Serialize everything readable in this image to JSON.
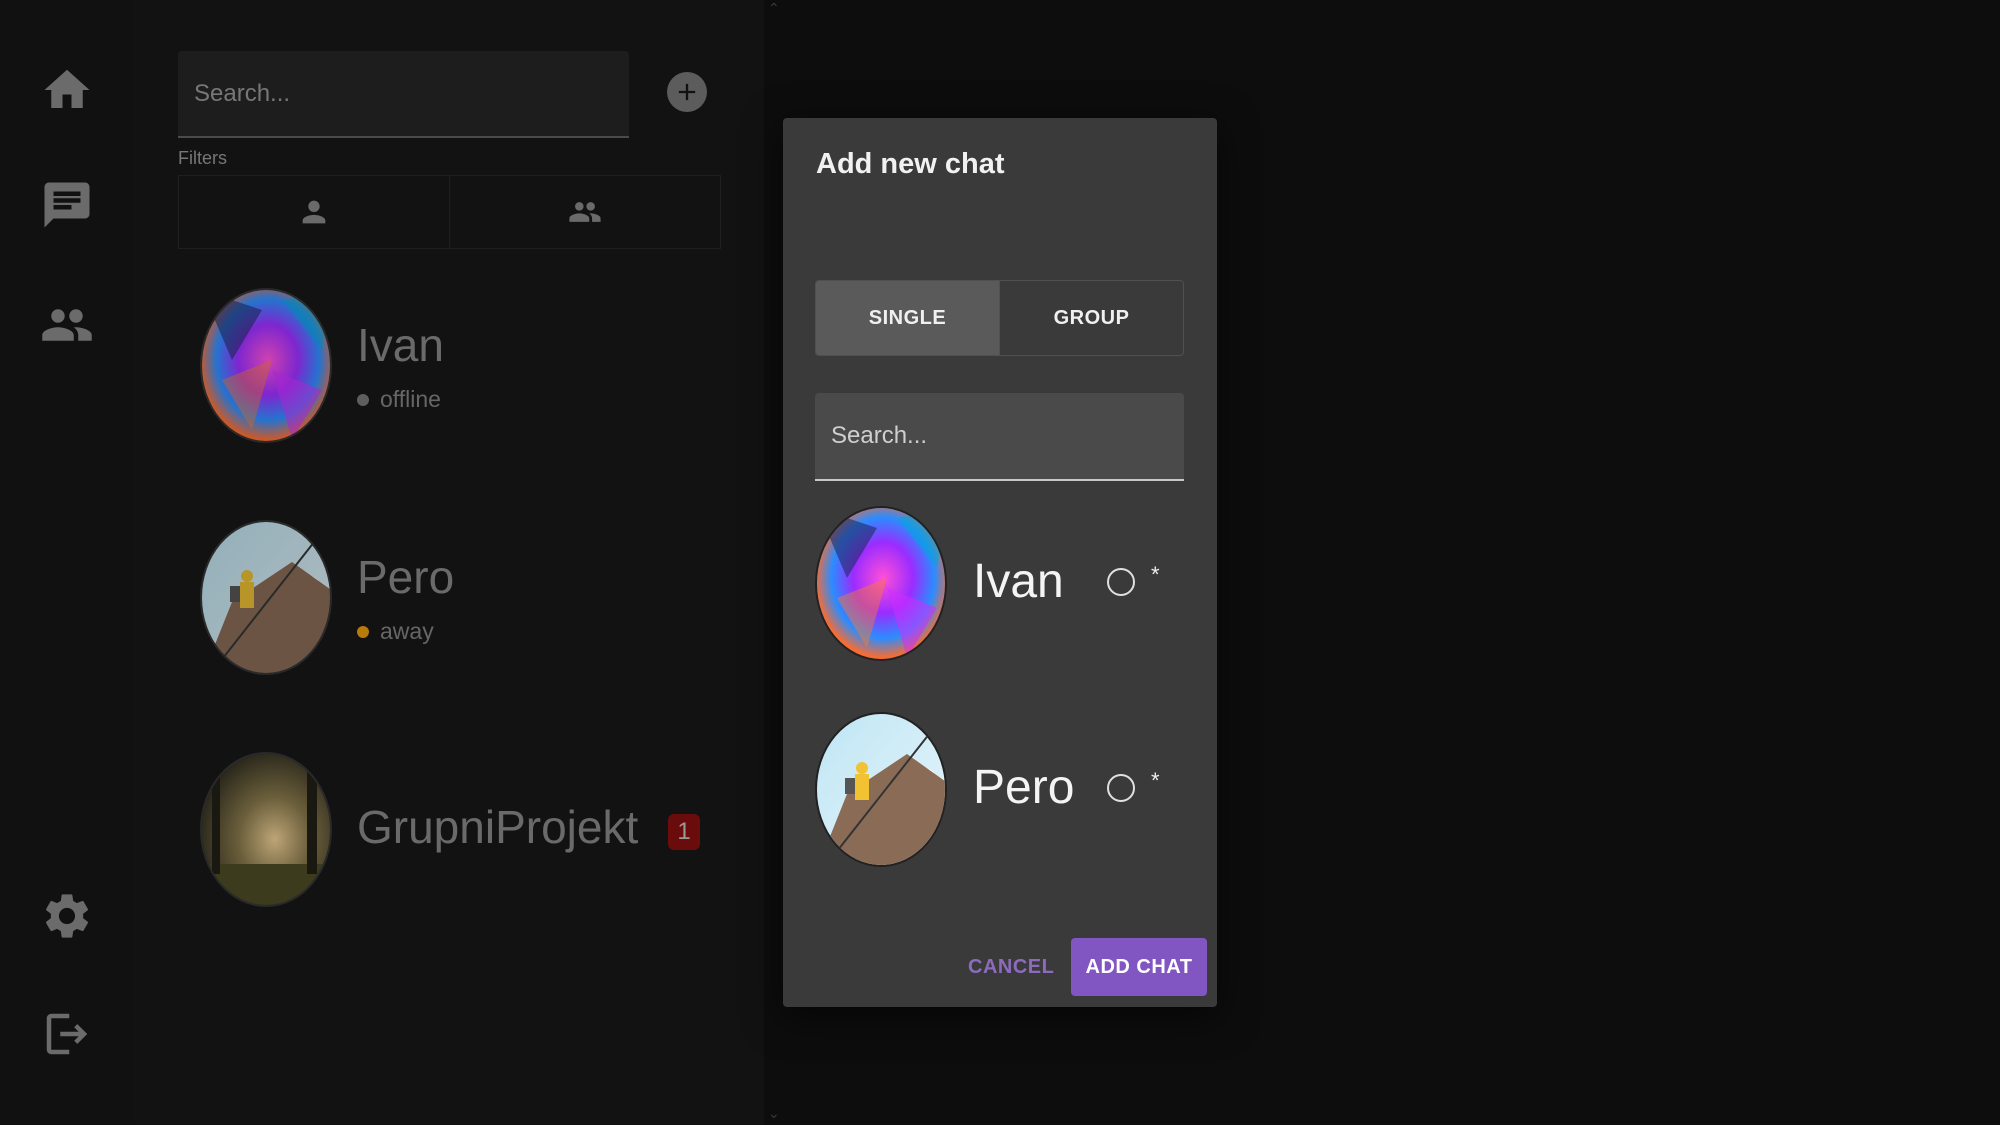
{
  "sidebar": {
    "items": [
      {
        "icon": "home-icon"
      },
      {
        "icon": "chat-icon"
      },
      {
        "icon": "contacts-icon"
      },
      {
        "icon": "settings-icon"
      },
      {
        "icon": "logout-icon"
      }
    ]
  },
  "chat_list": {
    "search_placeholder": "Search...",
    "filters_label": "Filters",
    "filters": [
      {
        "icon": "person-icon"
      },
      {
        "icon": "group-icon"
      }
    ],
    "chats": [
      {
        "name": "Ivan",
        "status": "offline",
        "status_color": "#6a6a6a"
      },
      {
        "name": "Pero",
        "status": "away",
        "status_color": "#c58a0d"
      },
      {
        "name": "GrupniProjekt",
        "unread": "1"
      }
    ]
  },
  "dialog": {
    "title": "Add new chat",
    "tabs": [
      {
        "label": "SINGLE",
        "active": true
      },
      {
        "label": "GROUP",
        "active": false
      }
    ],
    "search_placeholder": "Search...",
    "users": [
      {
        "name": "Ivan",
        "required_mark": "*"
      },
      {
        "name": "Pero",
        "required_mark": "*"
      }
    ],
    "cancel_label": "CANCEL",
    "add_label": "ADD CHAT"
  },
  "colors": {
    "accent": "#8155c2",
    "badge": "#6a0c0c"
  }
}
